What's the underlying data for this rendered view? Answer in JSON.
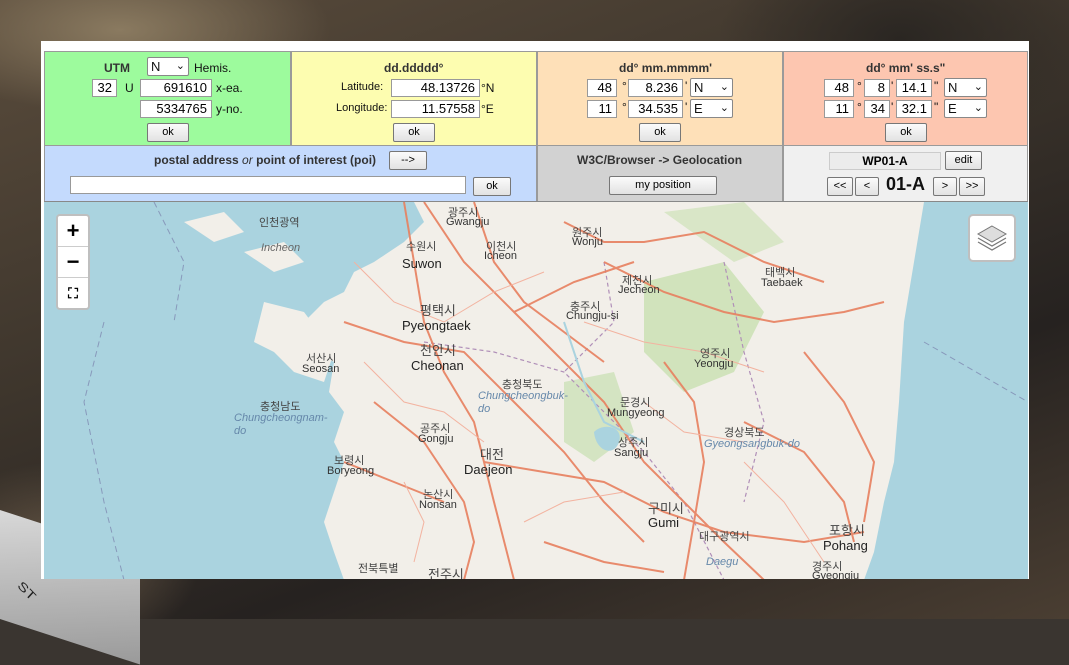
{
  "utm": {
    "title": "UTM",
    "hemis_value": "N",
    "hemis_label": "Hemis.",
    "zone_number": "32",
    "zone_letter": "U",
    "easting": "691610",
    "easting_label": "x-ea.",
    "northing": "5334765",
    "northing_label": "y-no.",
    "ok_label": "ok"
  },
  "decimal": {
    "title": "dd.ddddd°",
    "lat_label": "Latitude:",
    "lat_value": "48.13726",
    "lat_unit": "°N",
    "lon_label": "Longitude:",
    "lon_value": "11.57558",
    "lon_unit": "°E",
    "ok_label": "ok"
  },
  "deg_min": {
    "title": "dd° mm.mmmm'",
    "lat_deg": "48",
    "lat_min": "8.236",
    "lat_hem": "N",
    "lon_deg": "11",
    "lon_min": "34.535",
    "lon_hem": "E",
    "deg_symbol": "°",
    "min_symbol": "'",
    "ok_label": "ok"
  },
  "deg_min_sec": {
    "title": "dd° mm' ss.s\"",
    "lat_deg": "48",
    "lat_min": "8",
    "lat_sec": "14.1",
    "lat_hem": "N",
    "lon_deg": "11",
    "lon_min": "34",
    "lon_sec": "32.1",
    "lon_hem": "E",
    "deg_symbol": "°",
    "min_symbol": "'",
    "sec_symbol": "\"",
    "ok_label": "ok"
  },
  "poi": {
    "title_part1": "postal address",
    "title_or": "or",
    "title_part2": "point of interest (poi)",
    "arrow_label": "-->",
    "input_value": "",
    "ok_label": "ok"
  },
  "geolocation": {
    "title": "W3C/Browser -> Geolocation",
    "button_label": "my position"
  },
  "waypoint": {
    "name": "WP01-A",
    "edit_label": "edit",
    "first_label": "<<",
    "prev_label": "<",
    "current": "01-A",
    "next_label": ">",
    "last_label": ">>"
  },
  "map": {
    "zoom_in": "+",
    "zoom_out": "−",
    "fullscreen": "⛶",
    "places": [
      {
        "ko": "인천광역",
        "en": "Incheon"
      },
      {
        "ko": "수원시",
        "en": "Suwon"
      },
      {
        "ko": "광주시",
        "en": "Gwangju"
      },
      {
        "ko": "이천시",
        "en": "Icheon"
      },
      {
        "ko": "원주시",
        "en": "Wonju"
      },
      {
        "ko": "태백시",
        "en": "Taebaek"
      },
      {
        "ko": "제천시",
        "en": "Jecheon"
      },
      {
        "ko": "평택시",
        "en": "Pyeongtaek"
      },
      {
        "ko": "충주시",
        "en": "Chungju-si"
      },
      {
        "ko": "천안시",
        "en": "Cheonan"
      },
      {
        "ko": "서산시",
        "en": "Seosan"
      },
      {
        "ko": "영주시",
        "en": "Yeongju"
      },
      {
        "ko": "충청남도",
        "en": "Chungcheongnam-do"
      },
      {
        "ko": "충청북도",
        "en": "Chungcheongbuk-do"
      },
      {
        "ko": "문경시",
        "en": "Mungyeong"
      },
      {
        "ko": "공주시",
        "en": "Gongju"
      },
      {
        "ko": "대전",
        "en": "Daejeon"
      },
      {
        "ko": "상주시",
        "en": "Sangju"
      },
      {
        "ko": "경상북도",
        "en": "Gyeongsangbuk-do"
      },
      {
        "ko": "보령시",
        "en": "Boryeong"
      },
      {
        "ko": "논산시",
        "en": "Nonsan"
      },
      {
        "ko": "구미시",
        "en": "Gumi"
      },
      {
        "ko": "대구광역시",
        "en": "Daegu"
      },
      {
        "ko": "포항시",
        "en": "Pohang"
      },
      {
        "ko": "경주시",
        "en": "Gyeongju"
      },
      {
        "ko": "전주시",
        "en": ""
      },
      {
        "ko": "전북특별",
        "en": ""
      }
    ]
  },
  "colors": {
    "utm_bg": "#9dfb9d",
    "decimal_bg": "#fdfdb0",
    "degmin_bg": "#fee0b8",
    "dms_bg": "#fdc6b0",
    "poi_bg": "#c4dafd",
    "geo_bg": "#d2d2d2",
    "sea": "#aad3df",
    "land": "#f2efe9"
  }
}
